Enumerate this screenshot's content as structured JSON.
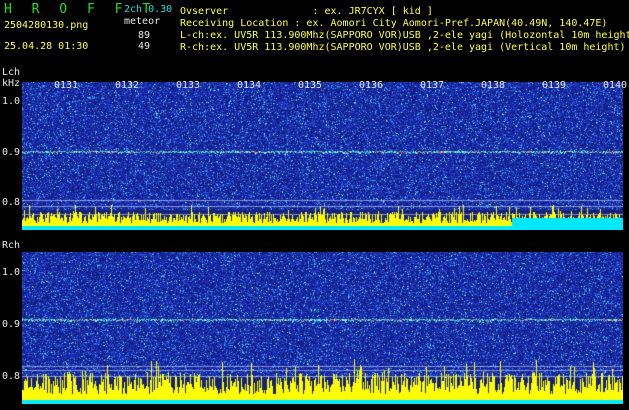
{
  "header": {
    "title": "H R O F F T",
    "filename": "2504280130.png",
    "datetime": "25.04.28 01:30",
    "version": "2ch 0.30",
    "meteor_label": "meteor",
    "meteor_lch_count": "89",
    "meteor_rch_count": "49"
  },
  "info": {
    "observer": "Ovserver              : ex. JR7CYX [ kid ]",
    "location": "Receiving Location : ex. Aomori City Aomori-Pref.JAPAN(40.49N, 140.47E)",
    "lch": "L-ch:ex. UV5R 113.900Mhz(SAPPORO VOR)USB ,2-ele yagi (Holozontal 10m height)",
    "rch": "R-ch:ex. UV5R 113.900Mhz(SAPPORO VOR)USB ,2-ele yagi (Vertical 10m height)"
  },
  "lch_panel": {
    "channel_label": "Lch",
    "unit_label": "kHz",
    "y_ticks": [
      "1.0",
      "0.9",
      "0.8"
    ]
  },
  "rch_panel": {
    "channel_label": "Rch",
    "y_ticks": [
      "1.0",
      "0.9",
      "0.8"
    ]
  },
  "time_labels": [
    "0131",
    "0132",
    "0133",
    "0134",
    "0135",
    "0136",
    "0137",
    "0138",
    "0139",
    "0140"
  ],
  "colors": {
    "background": "#000000",
    "header_green": "#22dd22",
    "header_cyan": "#22dddd",
    "header_yellow": "#ffff44",
    "spectrogram_base": "#1a2a8c",
    "meteor_bars": "#ffff00",
    "baseline": "#00ffff",
    "signal_line": "#6fffd0"
  }
}
